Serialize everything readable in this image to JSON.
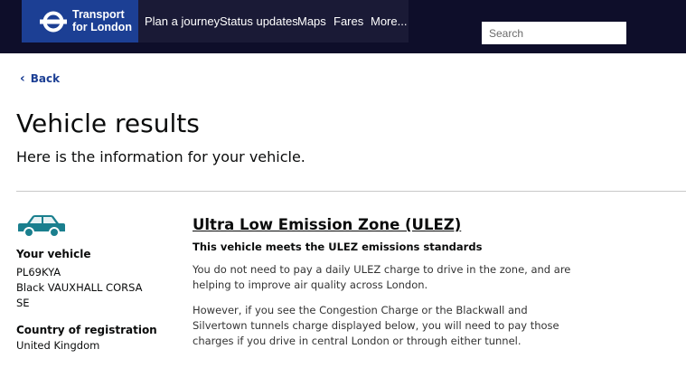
{
  "header": {
    "brand_line1": "Transport",
    "brand_line2": "for London",
    "nav": [
      "Plan a journey",
      "Status updates",
      "Maps",
      "Fares",
      "More..."
    ],
    "search_placeholder": "Search",
    "colors": {
      "bar": "#0e0e2a",
      "brand": "#1c3f94"
    }
  },
  "back_label": "Back",
  "page_title": "Vehicle results",
  "page_subtitle": "Here is the information for your vehicle.",
  "vehicle": {
    "icon": "car-icon",
    "label": "Your vehicle",
    "registration": "PL69KYA",
    "description": "Black VAUXHALL CORSA",
    "variant": "SE",
    "country_label": "Country of registration",
    "country": "United Kingdom",
    "icon_color": "#1a7f8e"
  },
  "ulez": {
    "title": "Ultra Low Emission Zone (ULEZ)",
    "status": "This vehicle meets the ULEZ emissions standards",
    "para1_line1": "You do not need to pay a daily ULEZ charge to drive in the zone, and are",
    "para1_line2": "helping to improve air quality across London.",
    "para2_line1": "However, if you see the Congestion Charge or the Blackwall and",
    "para2_line2": "Silvertown tunnels charge displayed below, you will need to pay those",
    "para2_line3": "charges if you drive in central London or through either tunnel."
  }
}
